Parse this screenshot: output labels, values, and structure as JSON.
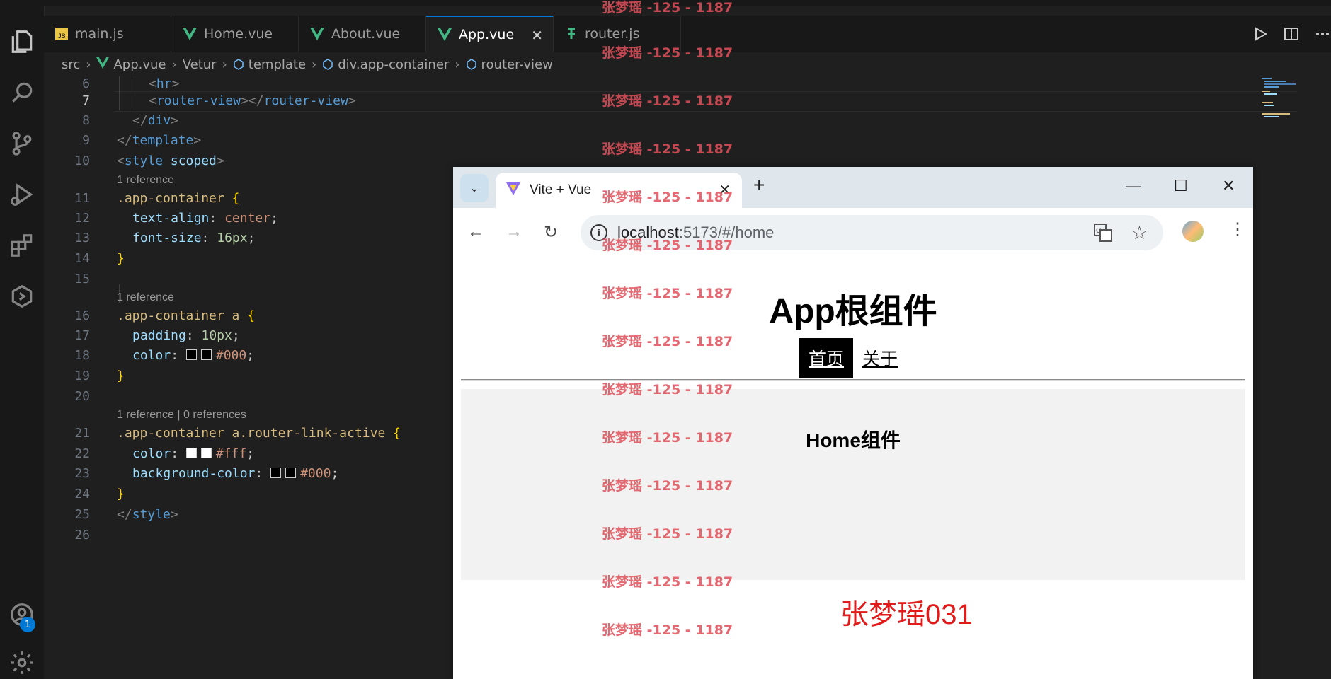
{
  "editor_tabs": [
    {
      "label": "main.js",
      "icon": "js-file-icon"
    },
    {
      "label": "Home.vue",
      "icon": "vue-file-icon"
    },
    {
      "label": "About.vue",
      "icon": "vue-file-icon"
    },
    {
      "label": "App.vue",
      "icon": "vue-file-icon",
      "active": true
    },
    {
      "label": "router.js",
      "icon": "router-file-icon"
    }
  ],
  "breadcrumb": [
    "src",
    "App.vue",
    "Vetur",
    "template",
    "div.app-container",
    "router-view"
  ],
  "code": {
    "line_numbers": [
      "6",
      "7",
      "8",
      "9",
      "10",
      "11",
      "12",
      "13",
      "14",
      "15",
      "16",
      "17",
      "18",
      "19",
      "20",
      "21",
      "22",
      "23",
      "24",
      "25",
      "26"
    ],
    "references": [
      "1 reference",
      "1 reference",
      "1 reference | 0 references"
    ],
    "l6": [
      "<",
      "hr",
      ">"
    ],
    "l7": [
      "<",
      "router-view",
      "></",
      "router-view",
      ">"
    ],
    "l8": [
      "</",
      "div",
      ">"
    ],
    "l9": [
      "</",
      "template",
      ">"
    ],
    "l10": [
      "<",
      "style",
      "scoped",
      ">"
    ],
    "l11": [
      ".app-container",
      "{"
    ],
    "l12": [
      "text-align",
      ": ",
      "center",
      ";"
    ],
    "l13": [
      "font-size",
      ": ",
      "16px",
      ";"
    ],
    "l14": [
      "}"
    ],
    "l16": [
      ".app-container a",
      "{"
    ],
    "l17": [
      "padding",
      ": ",
      "10px",
      ";"
    ],
    "l18": [
      "color",
      ": ",
      "#000",
      ";"
    ],
    "l19": [
      "}"
    ],
    "l21": [
      ".app-container a.router-link-active",
      "{"
    ],
    "l22": [
      "color",
      ": ",
      "#fff",
      ";"
    ],
    "l23": [
      "background-color",
      ": ",
      "#000",
      ";"
    ],
    "l24": [
      "}"
    ],
    "l25": [
      "</",
      "style",
      ">"
    ]
  },
  "activity_badge": "1",
  "browser": {
    "tab_title": "Vite + Vue",
    "url_host": "localhost",
    "url_path": ":5173/#/home"
  },
  "app": {
    "title": "App根组件",
    "nav": [
      "首页",
      "关于"
    ],
    "home_heading": "Home组件",
    "signature": "张梦瑶031"
  },
  "watermark": "张梦瑶 -125 - 1187",
  "colors": {
    "accent": "#0078d4",
    "vue_green": "#41b883",
    "watermark": "#e0505a",
    "signature": "#e11a1a"
  }
}
